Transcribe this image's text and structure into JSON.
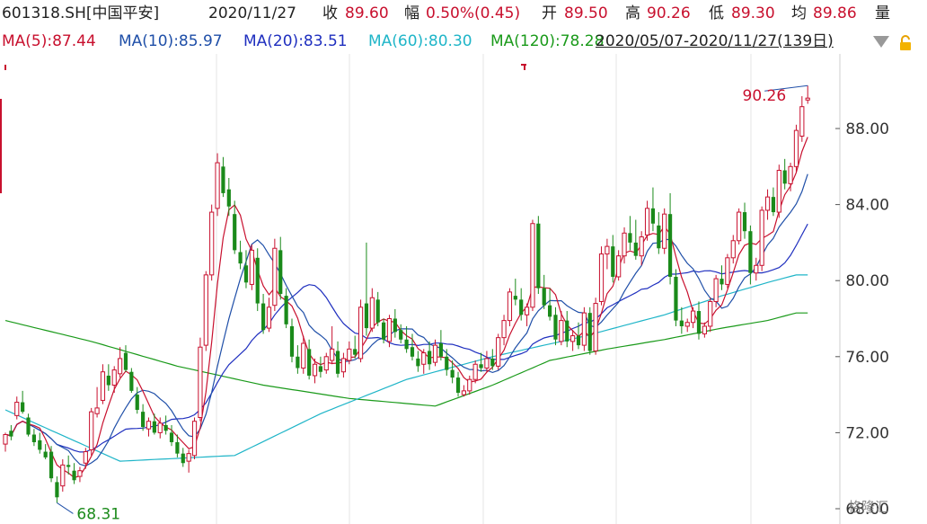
{
  "header": {
    "code": "601318.SH[中国平安]",
    "date": "2020/11/27",
    "close_label": "收",
    "close": "89.60",
    "change_label": "幅",
    "change": "0.50%(0.45)",
    "open_label": "开",
    "open": "89.50",
    "high_label": "高",
    "high": "90.26",
    "low_label": "低",
    "low": "89.30",
    "avg_label": "均",
    "avg": "89.86",
    "vol_label": "量"
  },
  "ma_bar": {
    "ma5": "MA(5):87.44",
    "ma10": "MA(10):85.97",
    "ma20": "MA(20):83.51",
    "ma60": "MA(60):80.30",
    "ma120": "MA(120):78.28",
    "range": "2020/05/07-2020/11/27(139日)",
    "dropdown_icon": "triangle-down-icon",
    "lock_icon": "lock-icon"
  },
  "watermark": "格隆汇",
  "colors": {
    "up": "#c8102e",
    "down": "#1a8a1a",
    "ma5": "#c8102e",
    "ma10": "#1f4fa8",
    "ma20": "#1f2fbf",
    "ma60": "#1fb5c8",
    "ma120": "#1a9a1a",
    "axis": "#333333"
  },
  "chart_data": {
    "type": "candlestick",
    "ylim": [
      68,
      91
    ],
    "yticks": [
      "88.00",
      "84.00",
      "80.00",
      "76.00",
      "72.00",
      "68.00"
    ],
    "high_label": "90.26",
    "low_label": "68.31",
    "candles": [
      [
        71.4,
        72.0,
        71.0,
        71.9
      ],
      [
        72.1,
        72.4,
        71.6,
        71.8
      ],
      [
        72.9,
        73.9,
        72.7,
        73.6
      ],
      [
        73.6,
        74.2,
        73.0,
        73.1
      ],
      [
        72.8,
        73.0,
        71.8,
        71.9
      ],
      [
        71.9,
        72.2,
        71.3,
        71.5
      ],
      [
        71.6,
        72.0,
        70.9,
        71.1
      ],
      [
        71.0,
        71.4,
        70.6,
        70.7
      ],
      [
        71.0,
        71.3,
        69.4,
        69.6
      ],
      [
        69.4,
        69.7,
        68.31,
        68.6
      ],
      [
        69.2,
        70.6,
        68.9,
        70.3
      ],
      [
        70.3,
        70.8,
        69.8,
        70.2
      ],
      [
        70.0,
        70.4,
        69.3,
        69.5
      ],
      [
        69.7,
        70.2,
        69.4,
        70.0
      ],
      [
        70.4,
        71.2,
        70.1,
        71.0
      ],
      [
        71.1,
        73.3,
        70.8,
        73.1
      ],
      [
        73.0,
        74.4,
        72.8,
        73.3
      ],
      [
        73.7,
        75.6,
        73.5,
        75.2
      ],
      [
        75.0,
        75.6,
        74.2,
        74.5
      ],
      [
        74.5,
        75.5,
        74.1,
        75.3
      ],
      [
        75.1,
        76.5,
        74.9,
        75.9
      ],
      [
        76.2,
        76.6,
        75.2,
        75.3
      ],
      [
        75.2,
        75.4,
        74.1,
        74.2
      ],
      [
        74.0,
        74.4,
        73.0,
        73.2
      ],
      [
        73.1,
        73.5,
        72.1,
        72.3
      ],
      [
        72.2,
        72.8,
        71.8,
        72.6
      ],
      [
        72.6,
        73.0,
        71.9,
        72.0
      ],
      [
        72.0,
        72.8,
        71.7,
        72.5
      ],
      [
        72.4,
        72.9,
        71.9,
        72.1
      ],
      [
        72.0,
        72.4,
        71.3,
        71.5
      ],
      [
        71.5,
        71.9,
        70.7,
        70.9
      ],
      [
        70.9,
        71.2,
        70.2,
        70.4
      ],
      [
        70.5,
        71.1,
        69.9,
        70.9
      ],
      [
        70.8,
        72.8,
        70.6,
        72.6
      ],
      [
        72.8,
        77.0,
        72.6,
        76.5
      ],
      [
        76.6,
        80.5,
        76.3,
        80.3
      ],
      [
        80.3,
        84.0,
        80.0,
        83.6
      ],
      [
        83.8,
        86.7,
        83.4,
        86.2
      ],
      [
        86.0,
        86.5,
        84.4,
        84.6
      ],
      [
        84.8,
        85.4,
        83.4,
        83.9
      ],
      [
        83.5,
        84.2,
        81.4,
        81.6
      ],
      [
        81.5,
        82.1,
        80.6,
        80.9
      ],
      [
        80.8,
        81.6,
        79.6,
        79.9
      ],
      [
        79.8,
        81.9,
        79.5,
        81.6
      ],
      [
        81.2,
        81.7,
        78.4,
        78.8
      ],
      [
        78.8,
        79.3,
        77.2,
        77.4
      ],
      [
        77.5,
        79.1,
        77.3,
        78.6
      ],
      [
        78.7,
        82.2,
        78.4,
        81.7
      ],
      [
        81.6,
        82.3,
        79.0,
        79.3
      ],
      [
        79.2,
        79.6,
        77.5,
        77.7
      ],
      [
        77.6,
        78.0,
        75.7,
        76.0
      ],
      [
        76.0,
        76.6,
        75.1,
        75.4
      ],
      [
        75.4,
        77.1,
        75.1,
        76.7
      ],
      [
        76.4,
        76.9,
        74.8,
        75.0
      ],
      [
        75.0,
        75.9,
        74.6,
        75.6
      ],
      [
        75.5,
        76.0,
        74.9,
        75.2
      ],
      [
        75.3,
        76.2,
        75.1,
        76.0
      ],
      [
        75.8,
        77.6,
        75.6,
        76.4
      ],
      [
        76.3,
        76.8,
        74.9,
        75.1
      ],
      [
        75.2,
        76.2,
        74.9,
        75.9
      ],
      [
        75.8,
        76.8,
        75.6,
        76.4
      ],
      [
        76.4,
        77.1,
        75.9,
        76.1
      ],
      [
        75.9,
        79.0,
        75.7,
        78.6
      ],
      [
        78.8,
        82.0,
        77.1,
        77.5
      ],
      [
        77.5,
        79.6,
        77.3,
        79.1
      ],
      [
        79.0,
        79.4,
        77.6,
        77.8
      ],
      [
        77.8,
        78.0,
        76.7,
        76.9
      ],
      [
        76.8,
        78.2,
        76.5,
        78.0
      ],
      [
        78.0,
        78.5,
        77.0,
        77.3
      ],
      [
        77.4,
        77.7,
        76.7,
        76.9
      ],
      [
        76.9,
        77.6,
        76.2,
        76.4
      ],
      [
        76.5,
        77.2,
        75.8,
        76.0
      ],
      [
        75.9,
        76.3,
        75.2,
        75.5
      ],
      [
        75.6,
        76.4,
        75.1,
        76.2
      ],
      [
        76.3,
        76.8,
        75.3,
        75.6
      ],
      [
        75.7,
        76.9,
        75.5,
        76.6
      ],
      [
        76.7,
        77.4,
        75.8,
        76.0
      ],
      [
        76.0,
        76.4,
        75.0,
        75.3
      ],
      [
        75.3,
        75.8,
        74.6,
        74.9
      ],
      [
        74.9,
        75.2,
        73.9,
        74.1
      ],
      [
        74.0,
        74.5,
        73.9,
        74.2
      ],
      [
        74.2,
        75.0,
        74.0,
        74.8
      ],
      [
        74.8,
        75.8,
        74.6,
        75.6
      ],
      [
        75.6,
        76.2,
        75.2,
        75.4
      ],
      [
        75.4,
        76.3,
        75.2,
        75.9
      ],
      [
        75.9,
        76.4,
        75.3,
        75.5
      ],
      [
        75.5,
        77.2,
        75.3,
        77.0
      ],
      [
        77.0,
        78.2,
        76.6,
        77.9
      ],
      [
        77.9,
        79.6,
        77.6,
        79.4
      ],
      [
        79.2,
        80.1,
        78.7,
        79.0
      ],
      [
        79.0,
        79.6,
        77.9,
        78.2
      ],
      [
        78.2,
        78.8,
        77.6,
        78.6
      ],
      [
        78.6,
        83.2,
        78.4,
        83.0
      ],
      [
        83.0,
        83.4,
        79.3,
        79.6
      ],
      [
        79.6,
        80.3,
        78.5,
        78.7
      ],
      [
        78.7,
        79.6,
        77.9,
        78.1
      ],
      [
        78.2,
        78.6,
        76.6,
        76.9
      ],
      [
        76.8,
        78.4,
        76.6,
        77.9
      ],
      [
        77.9,
        78.4,
        76.5,
        76.8
      ],
      [
        76.8,
        77.4,
        76.3,
        77.1
      ],
      [
        77.1,
        77.8,
        76.4,
        76.6
      ],
      [
        76.6,
        78.6,
        76.3,
        78.3
      ],
      [
        78.3,
        78.6,
        76.1,
        76.3
      ],
      [
        76.3,
        79.1,
        76.1,
        78.8
      ],
      [
        78.9,
        81.8,
        78.7,
        81.4
      ],
      [
        81.4,
        82.2,
        80.6,
        81.8
      ],
      [
        81.8,
        82.4,
        79.9,
        80.2
      ],
      [
        80.2,
        81.6,
        80.0,
        81.3
      ],
      [
        81.3,
        82.8,
        80.9,
        82.5
      ],
      [
        82.5,
        83.4,
        81.6,
        82.0
      ],
      [
        82.0,
        83.2,
        81.1,
        81.3
      ],
      [
        81.3,
        82.6,
        80.8,
        82.3
      ],
      [
        82.4,
        84.2,
        82.1,
        83.8
      ],
      [
        83.8,
        84.9,
        82.6,
        83.0
      ],
      [
        82.9,
        83.6,
        81.4,
        81.7
      ],
      [
        81.7,
        83.8,
        81.4,
        83.5
      ],
      [
        83.5,
        84.6,
        79.8,
        80.2
      ],
      [
        80.2,
        80.6,
        77.6,
        77.9
      ],
      [
        77.9,
        78.6,
        77.2,
        77.6
      ],
      [
        77.6,
        78.0,
        77.3,
        77.8
      ],
      [
        77.8,
        78.6,
        77.5,
        78.4
      ],
      [
        78.4,
        78.9,
        76.9,
        77.2
      ],
      [
        77.2,
        77.8,
        77.0,
        77.6
      ],
      [
        77.6,
        79.1,
        77.3,
        78.9
      ],
      [
        78.9,
        80.3,
        78.6,
        80.1
      ],
      [
        80.1,
        80.8,
        79.5,
        79.8
      ],
      [
        79.8,
        81.4,
        79.6,
        81.2
      ],
      [
        81.2,
        82.4,
        80.9,
        82.1
      ],
      [
        82.1,
        83.8,
        81.9,
        83.6
      ],
      [
        83.6,
        84.1,
        82.2,
        82.6
      ],
      [
        82.6,
        82.9,
        79.8,
        80.4
      ],
      [
        80.4,
        81.2,
        80.0,
        80.8
      ],
      [
        80.8,
        83.9,
        80.5,
        83.7
      ],
      [
        83.7,
        84.8,
        83.2,
        84.4
      ],
      [
        84.4,
        84.9,
        83.4,
        83.6
      ],
      [
        83.6,
        86.1,
        83.3,
        85.8
      ],
      [
        85.8,
        86.4,
        84.8,
        85.1
      ],
      [
        85.1,
        86.2,
        84.7,
        86.0
      ],
      [
        86.0,
        88.2,
        85.7,
        87.9
      ],
      [
        87.6,
        89.7,
        87.3,
        89.15
      ],
      [
        89.5,
        90.26,
        89.3,
        89.6
      ]
    ],
    "ma60_anchor": [
      [
        0,
        73.2
      ],
      [
        20,
        70.5
      ],
      [
        40,
        70.8
      ],
      [
        55,
        73.0
      ],
      [
        70,
        74.8
      ],
      [
        85,
        76.0
      ],
      [
        100,
        77.0
      ],
      [
        115,
        78.2
      ],
      [
        125,
        79.2
      ],
      [
        133,
        79.9
      ],
      [
        138,
        80.3
      ]
    ],
    "ma120_anchor": [
      [
        0,
        77.9
      ],
      [
        15,
        76.8
      ],
      [
        30,
        75.5
      ],
      [
        45,
        74.5
      ],
      [
        60,
        73.8
      ],
      [
        75,
        73.4
      ],
      [
        85,
        74.5
      ],
      [
        95,
        75.8
      ],
      [
        105,
        76.4
      ],
      [
        115,
        76.9
      ],
      [
        125,
        77.5
      ],
      [
        133,
        77.9
      ],
      [
        138,
        78.3
      ]
    ]
  }
}
